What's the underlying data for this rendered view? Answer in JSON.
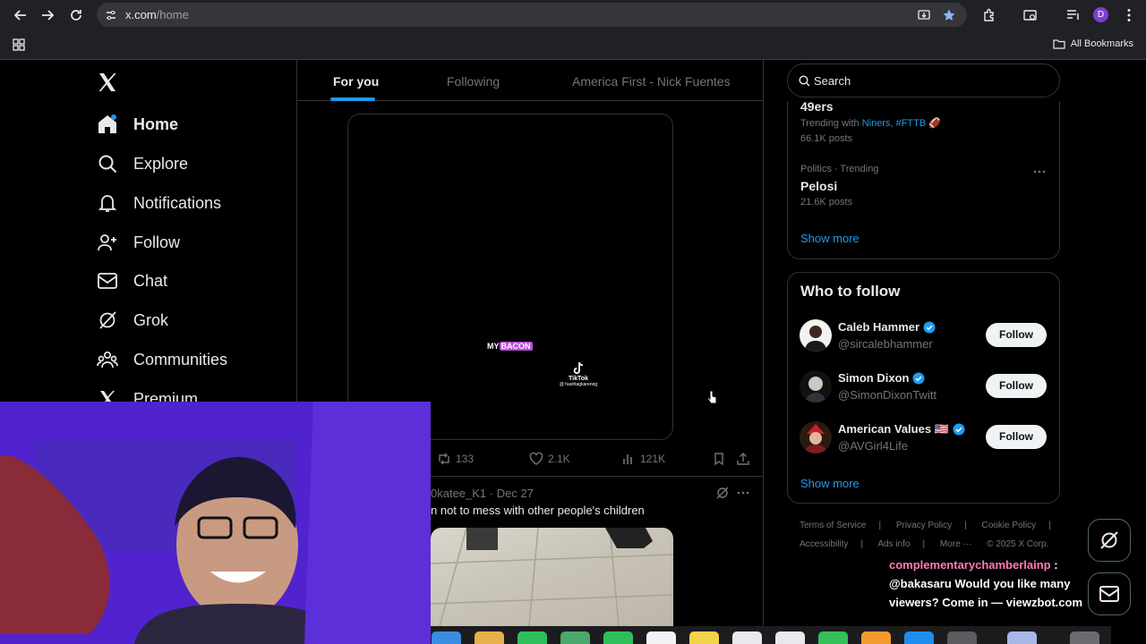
{
  "browser": {
    "url_host": "x.com",
    "url_path": "/home",
    "profile_initial": "D",
    "bookmarks_label": "All Bookmarks"
  },
  "nav": {
    "items": [
      {
        "label": "Home",
        "icon": "home-icon",
        "active": true
      },
      {
        "label": "Explore",
        "icon": "search-icon"
      },
      {
        "label": "Notifications",
        "icon": "bell-icon"
      },
      {
        "label": "Follow",
        "icon": "person-plus-icon"
      },
      {
        "label": "Chat",
        "icon": "mail-icon"
      },
      {
        "label": "Grok",
        "icon": "grok-icon"
      },
      {
        "label": "Communities",
        "icon": "people-icon"
      },
      {
        "label": "Premium",
        "icon": "x-icon"
      }
    ]
  },
  "timeline": {
    "tabs": [
      {
        "label": "For you",
        "active": true
      },
      {
        "label": "Following"
      },
      {
        "label": "America First - Nick Fuentes"
      }
    ]
  },
  "post1": {
    "video_caption_plain": "MY",
    "video_caption_highlight": "BACON",
    "watermark_name": "TikTok",
    "watermark_handle": "@ hashtagkarenog",
    "reposts": "133",
    "likes": "2.1K",
    "views": "121K"
  },
  "post2": {
    "meta": "0katee_K1 · Dec 27",
    "text": "n not to mess with other people's children"
  },
  "search": {
    "placeholder": "Search"
  },
  "trends": [
    {
      "context": "",
      "title": "49ers",
      "trending_with_label": "Trending with",
      "trending_with": "Niners, #FTTB",
      "posts": "66.1K posts"
    },
    {
      "context": "Politics · Trending",
      "title": "Pelosi",
      "posts": "21.6K posts"
    }
  ],
  "trends_show_more": "Show more",
  "who_to_follow": {
    "title": "Who to follow",
    "users": [
      {
        "name": "Caleb Hammer",
        "handle": "@sircalebhammer",
        "button": "Follow"
      },
      {
        "name": "Simon Dixon",
        "handle": "@SimonDixonTwitt",
        "button": "Follow"
      },
      {
        "name": "American Values 🇺🇸",
        "handle": "@AVGirl4Life",
        "button": "Follow"
      }
    ],
    "show_more": "Show more"
  },
  "footer": {
    "row1": [
      "Terms of Service",
      "|",
      "Privacy Policy",
      "|",
      "Cookie Policy",
      "|"
    ],
    "row2": [
      "Accessibility",
      "|",
      "Ads info",
      "|",
      "More ···",
      "© 2025 X Corp."
    ]
  },
  "chat_overlay": {
    "user": "complementarychamberlainp",
    "sep": " :",
    "message": "@bakasaru Would you like many viewers? Come in — viewzbot.com"
  },
  "colors": {
    "accent": "#1d9bf0",
    "background": "#000000",
    "border": "#2f3336",
    "muted": "#71767b"
  }
}
